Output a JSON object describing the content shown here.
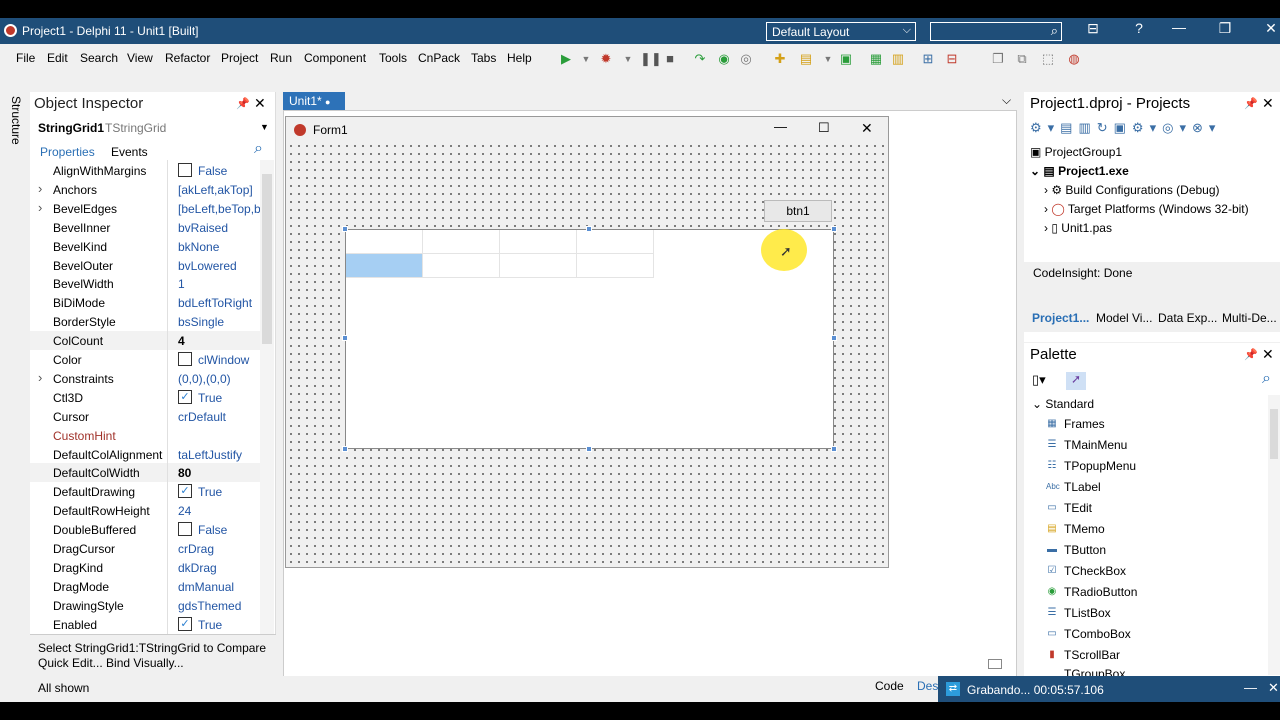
{
  "window": {
    "title": "Project1 - Delphi 11 - Unit1 [Built]",
    "layout": "Default Layout"
  },
  "menu": [
    "File",
    "Edit",
    "Search",
    "View",
    "Refactor",
    "Project",
    "Run",
    "Component",
    "Tools",
    "CnPack",
    "Tabs",
    "Help"
  ],
  "object_inspector": {
    "title": "Object Inspector",
    "structure_tab": "Structure",
    "component": "StringGrid1",
    "component_type": "TStringGrid",
    "tabs": [
      "Properties",
      "Events"
    ],
    "rows": [
      {
        "name": "AlignWithMargins",
        "value": "False",
        "check": false
      },
      {
        "name": "Anchors",
        "value": "[akLeft,akTop]",
        "expand": true
      },
      {
        "name": "BevelEdges",
        "value": "[beLeft,beTop,be",
        "expand": true
      },
      {
        "name": "BevelInner",
        "value": "bvRaised"
      },
      {
        "name": "BevelKind",
        "value": "bkNone"
      },
      {
        "name": "BevelOuter",
        "value": "bvLowered"
      },
      {
        "name": "BevelWidth",
        "value": "1"
      },
      {
        "name": "BiDiMode",
        "value": "bdLeftToRight"
      },
      {
        "name": "BorderStyle",
        "value": "bsSingle"
      },
      {
        "name": "ColCount",
        "value": "4",
        "bold": true
      },
      {
        "name": "Color",
        "value": "clWindow",
        "swatch": true
      },
      {
        "name": "Constraints",
        "value": "(0,0),(0,0)",
        "expand": true
      },
      {
        "name": "Ctl3D",
        "value": "True",
        "check": true
      },
      {
        "name": "Cursor",
        "value": "crDefault"
      },
      {
        "name": "CustomHint",
        "value": "",
        "red": true
      },
      {
        "name": "DefaultColAlignment",
        "value": "taLeftJustify"
      },
      {
        "name": "DefaultColWidth",
        "value": "80",
        "bold": true
      },
      {
        "name": "DefaultDrawing",
        "value": "True",
        "check": true
      },
      {
        "name": "DefaultRowHeight",
        "value": "24"
      },
      {
        "name": "DoubleBuffered",
        "value": "False",
        "check": false
      },
      {
        "name": "DragCursor",
        "value": "crDrag"
      },
      {
        "name": "DragKind",
        "value": "dkDrag"
      },
      {
        "name": "DragMode",
        "value": "dmManual"
      },
      {
        "name": "DrawingStyle",
        "value": "gdsThemed"
      },
      {
        "name": "Enabled",
        "value": "True",
        "check": true
      }
    ],
    "hint": "Select StringGrid1:TStringGrid to Compare",
    "hint_links": "Quick Edit...  Bind Visually...",
    "status": "All shown"
  },
  "editor": {
    "tab": "Unit1*",
    "form_title": "Form1",
    "button_caption": "btn1",
    "bottom_tabs": [
      "Code",
      "Des"
    ]
  },
  "projects": {
    "title": "Project1.dproj - Projects",
    "tree": [
      "ProjectGroup1",
      "Project1.exe",
      "Build Configurations (Debug)",
      "Target Platforms (Windows 32-bit)",
      "Unit1.pas"
    ],
    "status": "CodeInsight: Done",
    "tabs": [
      "Project1...",
      "Model Vi...",
      "Data Exp...",
      "Multi-De..."
    ]
  },
  "palette": {
    "title": "Palette",
    "category": "Standard",
    "items": [
      "Frames",
      "TMainMenu",
      "TPopupMenu",
      "TLabel",
      "TEdit",
      "TMemo",
      "TButton",
      "TCheckBox",
      "TRadioButton",
      "TListBox",
      "TComboBox",
      "TScrollBar",
      "TGroupBox"
    ]
  },
  "recorder": {
    "label": "Grabando... 00:05:57.106"
  }
}
